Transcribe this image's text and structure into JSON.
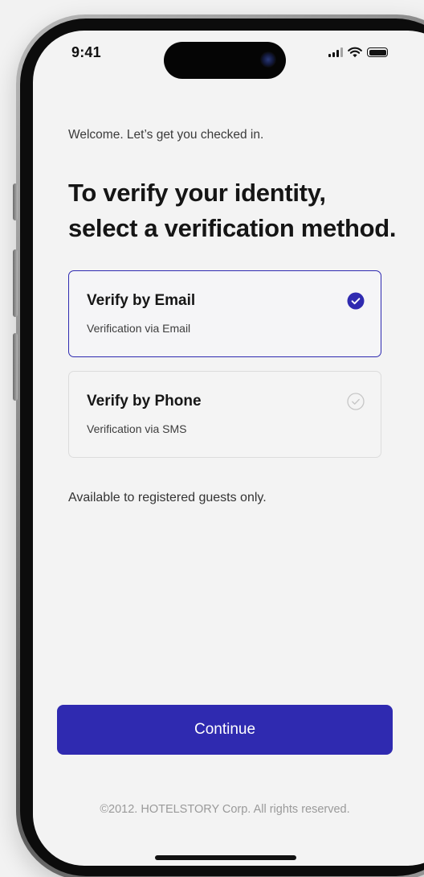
{
  "status_bar": {
    "time": "9:41"
  },
  "header": {
    "welcome": "Welcome. Let’s get you checked in.",
    "title_line1": "To verify your identity,",
    "title_line2": "select a verification method."
  },
  "options": [
    {
      "title": "Verify by Email",
      "subtitle": "Verification via Email",
      "selected": true,
      "icon": "check-circle-filled-icon"
    },
    {
      "title": "Verify by Phone",
      "subtitle": "Verification via SMS",
      "selected": false,
      "icon": "check-circle-outline-icon"
    }
  ],
  "note": "Available to registered guests only.",
  "continue_label": "Continue",
  "footer": "©2012. HOTELSTORY Corp. All rights reserved.",
  "colors": {
    "accent": "#2f2ab0",
    "background": "#f3f3f3",
    "text": "#151515",
    "muted": "#9a9a9a"
  }
}
